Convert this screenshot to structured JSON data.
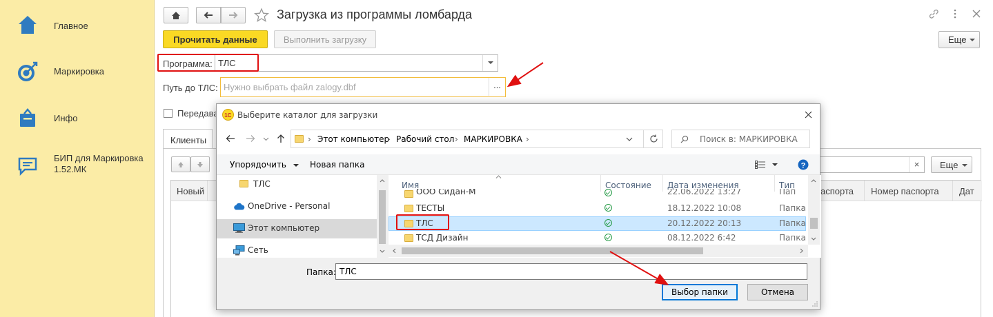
{
  "sidebar": {
    "items": [
      {
        "label": "Главное",
        "icon": "home-icon"
      },
      {
        "label": "Маркировка",
        "icon": "target-icon"
      },
      {
        "label": "Инфо",
        "icon": "info-bag-icon"
      },
      {
        "label": "БИП для Маркировка\n1.52.МК",
        "icon": "chat-icon"
      }
    ]
  },
  "header": {
    "title": "Загрузка из программы ломбарда",
    "more_label": "Еще"
  },
  "toolbar": {
    "read_data_label": "Прочитать данные",
    "do_load_label": "Выполнить загрузку"
  },
  "form": {
    "program_label": "Программа:",
    "program_value": "ТЛС",
    "path_label": "Путь до ТЛС:",
    "path_placeholder": "Нужно выбрать файл zalogy.dbf",
    "path_btn": "...",
    "transfer_label": "Передава"
  },
  "tabs": {
    "clients": "Клиенты"
  },
  "grid": {
    "more_label": "Еще",
    "clear_btn": "×",
    "columns": [
      "Новый",
      "паспорта",
      "Номер паспорта",
      "Дат"
    ]
  },
  "dialog": {
    "title": "Выберите каталог для загрузки",
    "breadcrumb": [
      "Этот компьютер",
      "Рабочий стол",
      "МАРКИРОВКА"
    ],
    "search_placeholder": "Поиск в: МАРКИРОВКА",
    "organize_label": "Упорядочить",
    "new_folder_label": "Новая папка",
    "tree": [
      {
        "label": "ТЛС",
        "icon": "folder-icon"
      },
      {
        "label": "OneDrive - Personal",
        "icon": "onedrive-icon"
      },
      {
        "label": "Этот компьютер",
        "icon": "computer-icon"
      },
      {
        "label": "Сеть",
        "icon": "network-icon"
      }
    ],
    "columns": [
      "Имя",
      "Состояние",
      "Дата изменения",
      "Тип"
    ],
    "files": [
      {
        "name": "ООО Сидан-М",
        "date": "22.06.2022 13:27",
        "type": "Папка с"
      },
      {
        "name": "ТЕСТЫ",
        "date": "18.12.2022 10:08",
        "type": "Папка с"
      },
      {
        "name": "ТЛС",
        "date": "20.12.2022 20:13",
        "type": "Папка с"
      },
      {
        "name": "ТСД Дизайн",
        "date": "08.12.2022 6:42",
        "type": "Папка с"
      }
    ],
    "folder_label": "Папка:",
    "folder_value": "ТЛС",
    "select_label": "Выбор папки",
    "cancel_label": "Отмена"
  },
  "colors": {
    "sidebar_bg": "#fbeca6",
    "accent_yellow": "#fad924",
    "highlight_red": "#e01010",
    "selection_blue": "#cce8ff",
    "icon_blue": "#2f7bc0"
  }
}
